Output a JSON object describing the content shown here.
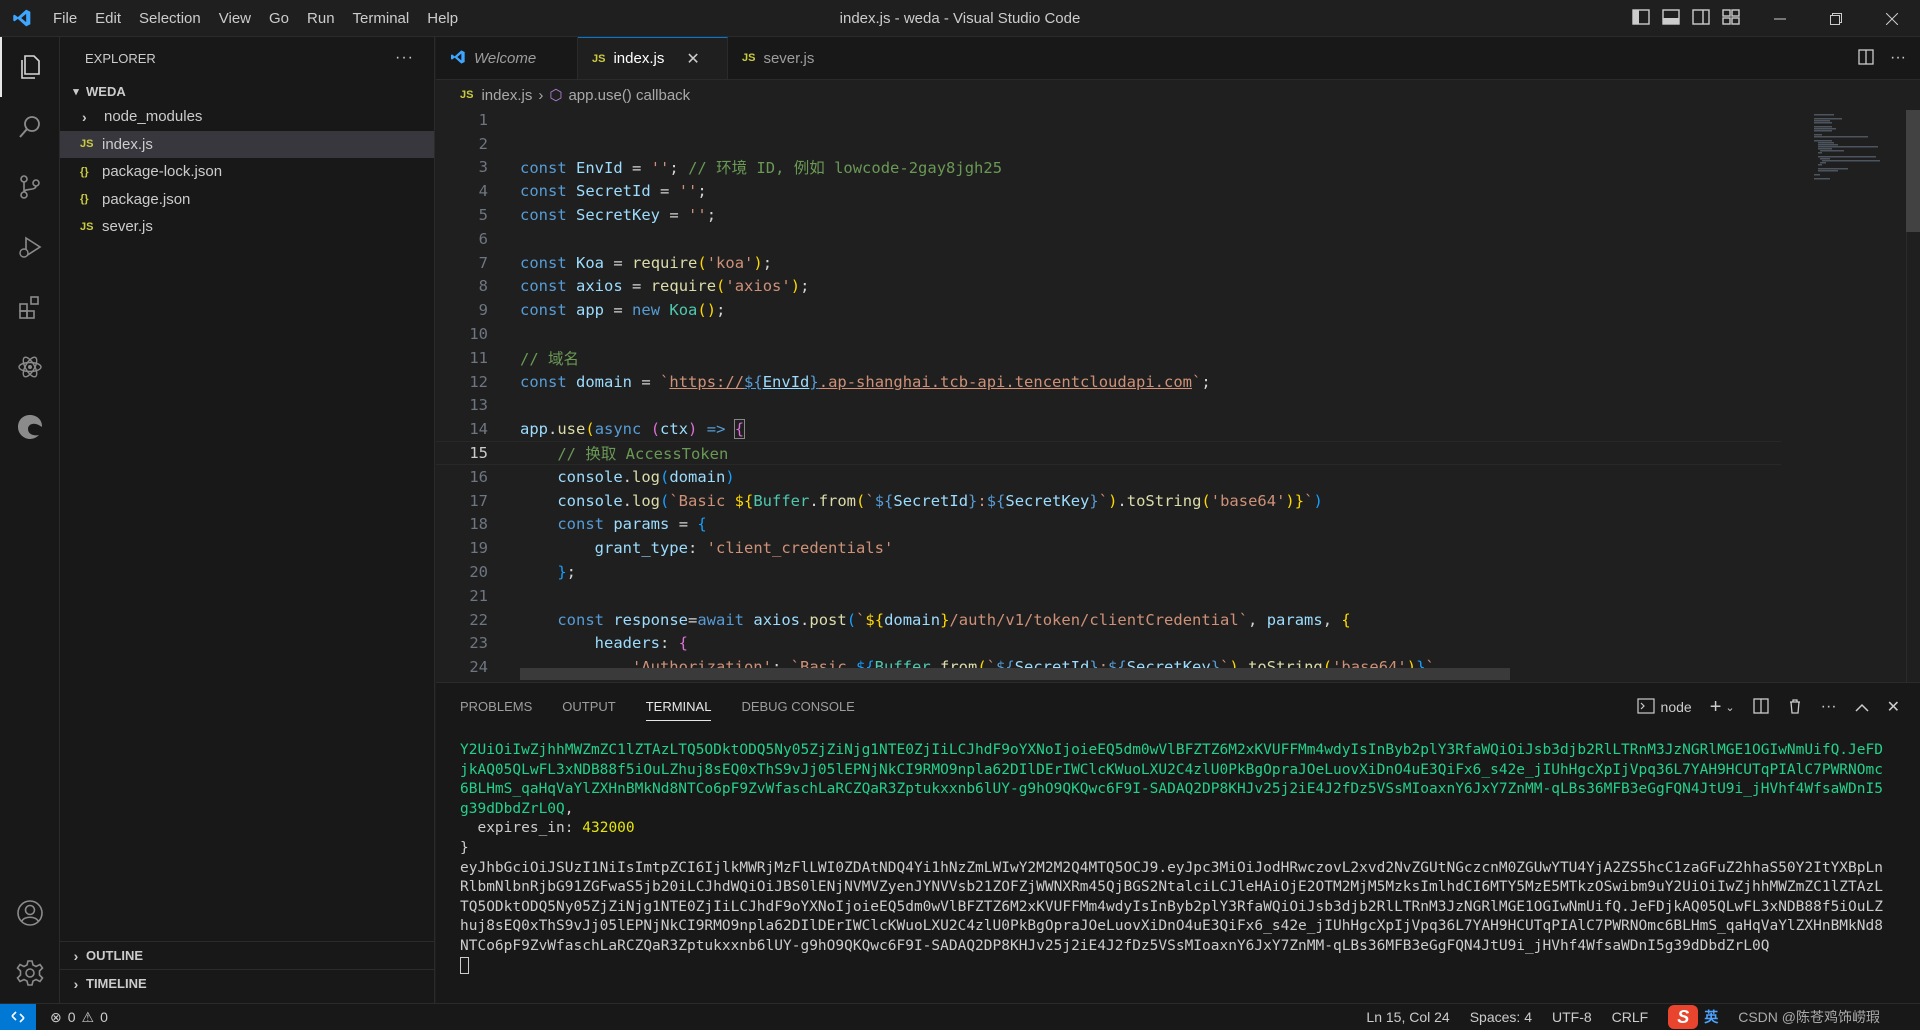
{
  "window": {
    "title": "index.js - weda - Visual Studio Code"
  },
  "menu": [
    "File",
    "Edit",
    "Selection",
    "View",
    "Go",
    "Run",
    "Terminal",
    "Help"
  ],
  "sidebar": {
    "title": "EXPLORER",
    "folder": "WEDA",
    "items": [
      {
        "label": "node_modules",
        "kind": "folder"
      },
      {
        "label": "index.js",
        "kind": "js"
      },
      {
        "label": "package-lock.json",
        "kind": "json"
      },
      {
        "label": "package.json",
        "kind": "json"
      },
      {
        "label": "sever.js",
        "kind": "js"
      }
    ],
    "outline": "OUTLINE",
    "timeline": "TIMELINE"
  },
  "tabs": [
    {
      "label": "Welcome"
    },
    {
      "label": "index.js"
    },
    {
      "label": "sever.js"
    }
  ],
  "breadcrumb": {
    "file": "index.js",
    "symbol": "app.use() callback"
  },
  "editor": {
    "line_numbers": [
      "1",
      "2",
      "3",
      "4",
      "5",
      "6",
      "7",
      "8",
      "9",
      "10",
      "11",
      "12",
      "13",
      "14",
      "15",
      "16",
      "17",
      "18",
      "19",
      "20",
      "21",
      "22",
      "23",
      "24"
    ],
    "current_line": 15
  },
  "panel": {
    "tabs": [
      "PROBLEMS",
      "OUTPUT",
      "TERMINAL",
      "DEBUG CONSOLE"
    ],
    "terminal_name": "node",
    "terminal": {
      "token1": "Y2UiOiIwZjhhMWZmZC1lZTAzLTQ5ODktODQ5Ny05ZjZiNjg1NTE0ZjIiLCJhdF9oYXNoIjoieEQ5dm0wVlBFZTZ6M2xKVUFFMm4wdyIsInByb2plY3RfaWQiOiJsb3djb2RlLTRnM3JzNGRlMGE1OGIwNmUifQ.JeFDjkAQ05QLwFL3xNDB88f5iOuLZhuj8sEQ0xThS9vJj05lEPNjNkCI9RMO9npla62DIlDErIWClcKWuoLXU2C4zlU0PkBgOpraJOeLuovXiDnO4uE3QiFx6_s42e_jIUhHgcXpIjVpq36L7YAH9HCUTqPIAlC7PWRNOmc6BLHmS_qaHqVaYlZXHnBMkNd8NTCo6pF9ZvWfaschLaRCZQaR3Zptukxxnb6lUY-g9hO9QKQwc6F9I-SADAQ2DP8KHJv25j2iE4J2fDz5VSsMIoaxnY6JxY7ZnMM-qLBs36MFB3eGgFQN4JtU9i_jHVhf4WfsaWDnI5g39dDbdZrL0Q",
      "expires_key": "expires_in",
      "expires_val": "432000",
      "token2": "eyJhbGciOiJSUzI1NiIsImtpZCI6IjlkMWRjMzFlLWI0ZDAtNDQ4Yi1hNzZmLWIwY2M2M2Q4MTQ5OCJ9.eyJpc3MiOiJodHRwczovL2xvd2NvZGUtNGczcnM0ZGUwYTU4YjA2ZS5hcC1zaGFuZ2hhaS50Y2ItYXBpLnRlbmNlbnRjbG91ZGFwaS5jb20iLCJhdWQiOiJBS0lENjNVMVZyenJYNVVsb21ZOFZjWWNXRm45QjBGS2NtalciLCJleHAiOjE2OTM2MjM5MzksImlhdCI6MTY5MzE5MTkzOSwibm9uY2UiOiIwZjhhMWZmZC1lZTAzLTQ5ODktODQ5Ny05ZjZiNjg1NTE0ZjIiLCJhdF9oYXNoIjoieEQ5dm0wVlBFZTZ6M2xKVUFFMm4wdyIsInByb2plY3RfaWQiOiJsb3djb2RlLTRnM3JzNGRlMGE1OGIwNmUifQ.JeFDjkAQ05QLwFL3xNDB88f5iOuLZhuj8sEQ0xThS9vJj05lEPNjNkCI9RMO9npla62DIlDErIWClcKWuoLXU2C4zlU0PkBgOpraJOeLuovXiDnO4uE3QiFx6_s42e_jIUhHgcXpIjVpq36L7YAH9HCUTqPIAlC7PWRNOmc6BLHmS_qaHqVaYlZXHnBMkNd8NTCo6pF9ZvWfaschLaRCZQaR3Zptukxxnb6lUY-g9hO9QKQwc6F9I-SADAQ2DP8KHJv25j2iE4J2fDz5VSsMIoaxnY6JxY7ZnMM-qLBs36MFB3eGgFQN4JtU9i_jHVhf4WfsaWDnI5g39dDbdZrL0Q"
    }
  },
  "status": {
    "errors": "0",
    "warnings": "0",
    "position": "Ln 15, Col 24",
    "spaces": "Spaces: 4",
    "encoding": "UTF-8",
    "eol": "CRLF",
    "ime": "英",
    "watermark": "CSDN @陈苍鸡饰崂瑕"
  }
}
